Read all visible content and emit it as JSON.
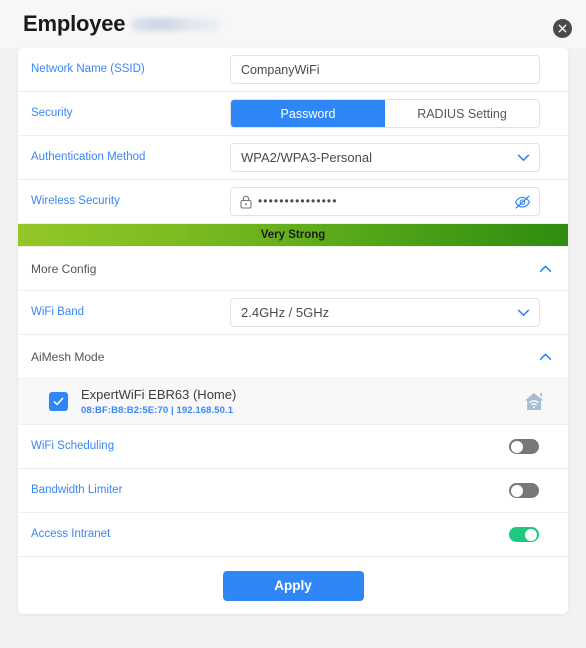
{
  "header": {
    "title": "Employee",
    "redacted_suffix": "",
    "close_icon": "close-icon"
  },
  "form": {
    "ssid": {
      "label": "Network Name (SSID)",
      "value": "CompanyWiFi",
      "placeholder": "Network Name (SSID)"
    },
    "security": {
      "label": "Security",
      "options": [
        "Password",
        "RADIUS Setting"
      ],
      "selected": "Password"
    },
    "auth_method": {
      "label": "Authentication Method",
      "value": "WPA2/WPA3-Personal",
      "chevron_icon": "chevron-down-icon"
    },
    "wireless_security": {
      "label": "Wireless Security",
      "masked_value": "•••••••••••••••",
      "lock_icon": "lock-icon",
      "eye_icon": "eye-off-icon"
    },
    "strength": {
      "text": "Very Strong",
      "gradient_from": "#94c726",
      "gradient_to": "#2f8c10"
    },
    "more_config": {
      "title": "More Config",
      "chevron_icon": "chevron-up-icon",
      "expanded": true
    },
    "wifi_band": {
      "label": "WiFi Band",
      "value": "2.4GHz / 5GHz",
      "chevron_icon": "chevron-down-icon"
    },
    "aimesh_mode": {
      "title": "AiMesh Mode",
      "chevron_icon": "chevron-up-icon",
      "expanded": true
    },
    "device": {
      "name": "ExpertWiFi EBR63 (Home)",
      "meta": "08:BF:B8:B2:5E:70 | 192.168.50.1",
      "checked": true,
      "check_icon": "check-icon",
      "device_icon": "home-wifi-icon"
    },
    "toggles": [
      {
        "label": "WiFi Scheduling",
        "state": "off"
      },
      {
        "label": "Bandwidth Limiter",
        "state": "off"
      },
      {
        "label": "Access Intranet",
        "state": "on"
      }
    ],
    "apply": {
      "label": "Apply"
    }
  },
  "colors": {
    "accent_blue": "#2f87f7",
    "label_blue": "#3a86f7",
    "toggle_on_green": "#1ec97e",
    "toggle_off_gray": "#78787c"
  }
}
